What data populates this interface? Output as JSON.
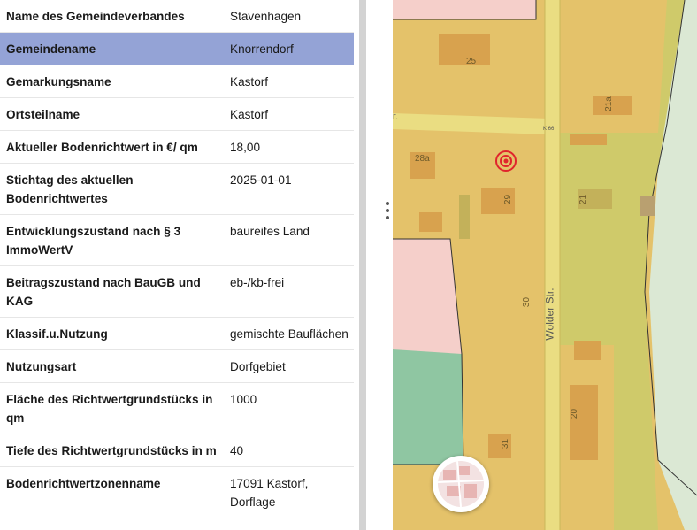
{
  "attributes": [
    {
      "key": "Name des Gemeindeverbandes",
      "value": "Stavenhagen",
      "selected": false
    },
    {
      "key": "Gemeindename",
      "value": "Knorrendorf",
      "selected": true
    },
    {
      "key": "Gemarkungsname",
      "value": "Kastorf",
      "selected": false
    },
    {
      "key": "Ortsteilname",
      "value": "Kastorf",
      "selected": false
    },
    {
      "key": "Aktueller Bodenrichtwert in €/ qm",
      "value": "18,00",
      "selected": false
    },
    {
      "key": "Stichtag des aktuellen Bodenrichtwertes",
      "value": "2025-01-01",
      "selected": false
    },
    {
      "key": "Entwicklungszustand nach § 3 ImmoWertV",
      "value": "baureifes Land",
      "selected": false
    },
    {
      "key": "Beitragszustand nach BauGB und KAG",
      "value": "eb-/kb-frei",
      "selected": false
    },
    {
      "key": "Klassif.u.Nutzung",
      "value": "gemischte Bauflächen",
      "selected": false
    },
    {
      "key": "Nutzungsart",
      "value": "Dorfgebiet",
      "selected": false
    },
    {
      "key": "Fläche des Richtwertgrundstücks in qm",
      "value": "1000",
      "selected": false
    },
    {
      "key": "Tiefe des Richtwertgrundstücks in m",
      "value": "40",
      "selected": false
    },
    {
      "key": "Bodenrichtwertzonenname",
      "value": "17091 Kastorf, Dorflage",
      "selected": false
    }
  ],
  "map": {
    "street_name": "Wolder Str.",
    "road_ref": "K 66",
    "street_fragment": "r.",
    "house_numbers": [
      "25",
      "28a",
      "29",
      "21",
      "21a",
      "30",
      "20",
      "31"
    ],
    "marker_icon": "location-target-icon",
    "basemap_toggle_icon": "basemap-thumbnail-icon",
    "colors": {
      "zone_orange": "#e4c26a",
      "zone_green": "#cfca6a",
      "zone_pink": "#f5cfca",
      "zone_light_green": "#dbe8d4",
      "zone_teal": "#8fc6a2",
      "road": "#eadd82",
      "building": "#d8a24e",
      "marker": "#e0242c",
      "selected_row": "#94a3d6"
    }
  }
}
